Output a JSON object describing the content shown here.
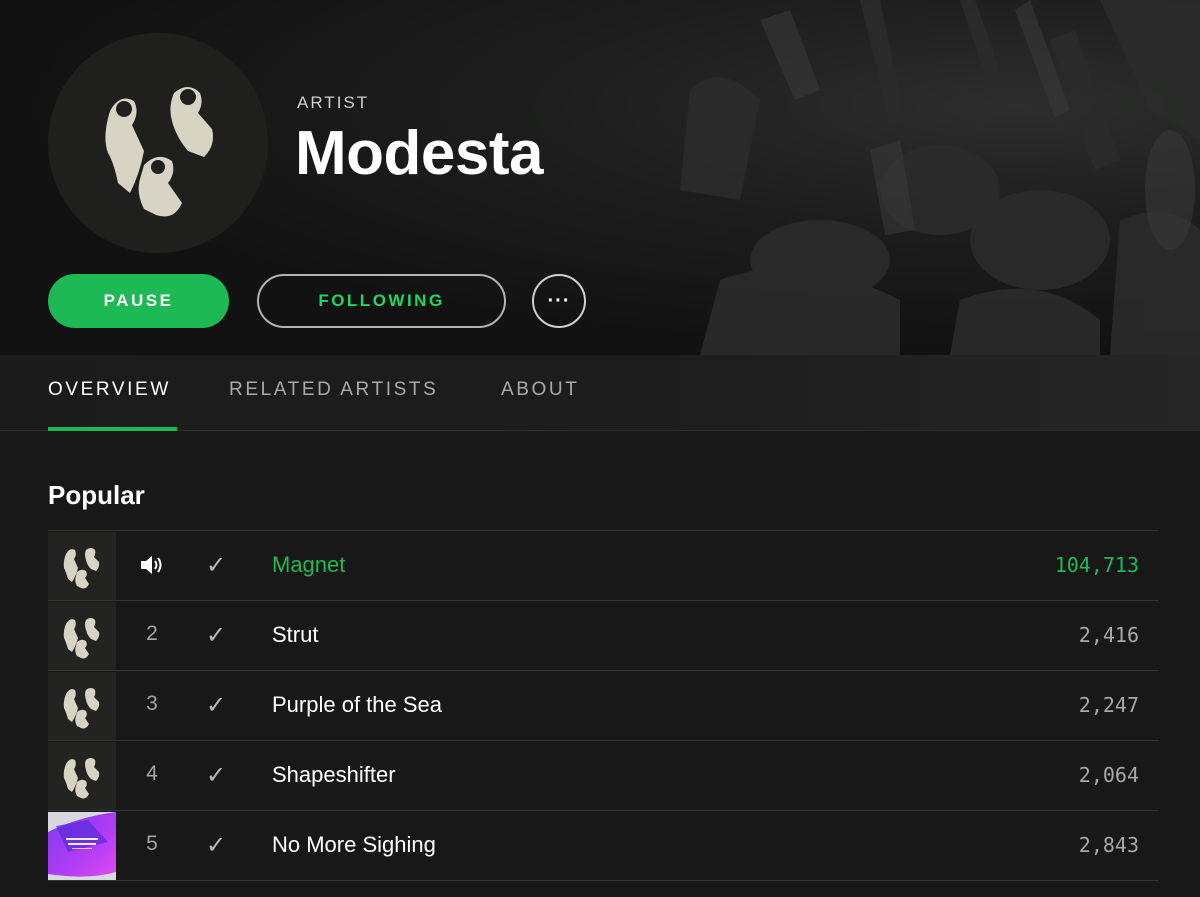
{
  "artist": {
    "type_label": "ARTIST",
    "name": "Modesta"
  },
  "actions": {
    "pause_label": "PAUSE",
    "following_label": "FOLLOWING",
    "more_label": "···"
  },
  "tabs": [
    {
      "label": "OVERVIEW",
      "active": true
    },
    {
      "label": "RELATED ARTISTS",
      "active": false
    },
    {
      "label": "ABOUT",
      "active": false
    }
  ],
  "popular": {
    "title": "Popular",
    "tracks": [
      {
        "index": "",
        "now_playing_icon": "speaker-icon",
        "title": "Magnet",
        "plays": "104,713",
        "playing": true,
        "art": "band-photo"
      },
      {
        "index": "2",
        "title": "Strut",
        "plays": "2,416",
        "playing": false,
        "art": "band-photo"
      },
      {
        "index": "3",
        "title": "Purple of the Sea",
        "plays": "2,247",
        "playing": false,
        "art": "band-photo"
      },
      {
        "index": "4",
        "title": "Shapeshifter",
        "plays": "2,064",
        "playing": false,
        "art": "band-photo"
      },
      {
        "index": "5",
        "title": "No More Sighing",
        "plays": "2,843",
        "playing": false,
        "art": "purple-cover"
      }
    ]
  },
  "colors": {
    "accent": "#1db954",
    "background": "#181818",
    "header_bg": "#121212"
  }
}
